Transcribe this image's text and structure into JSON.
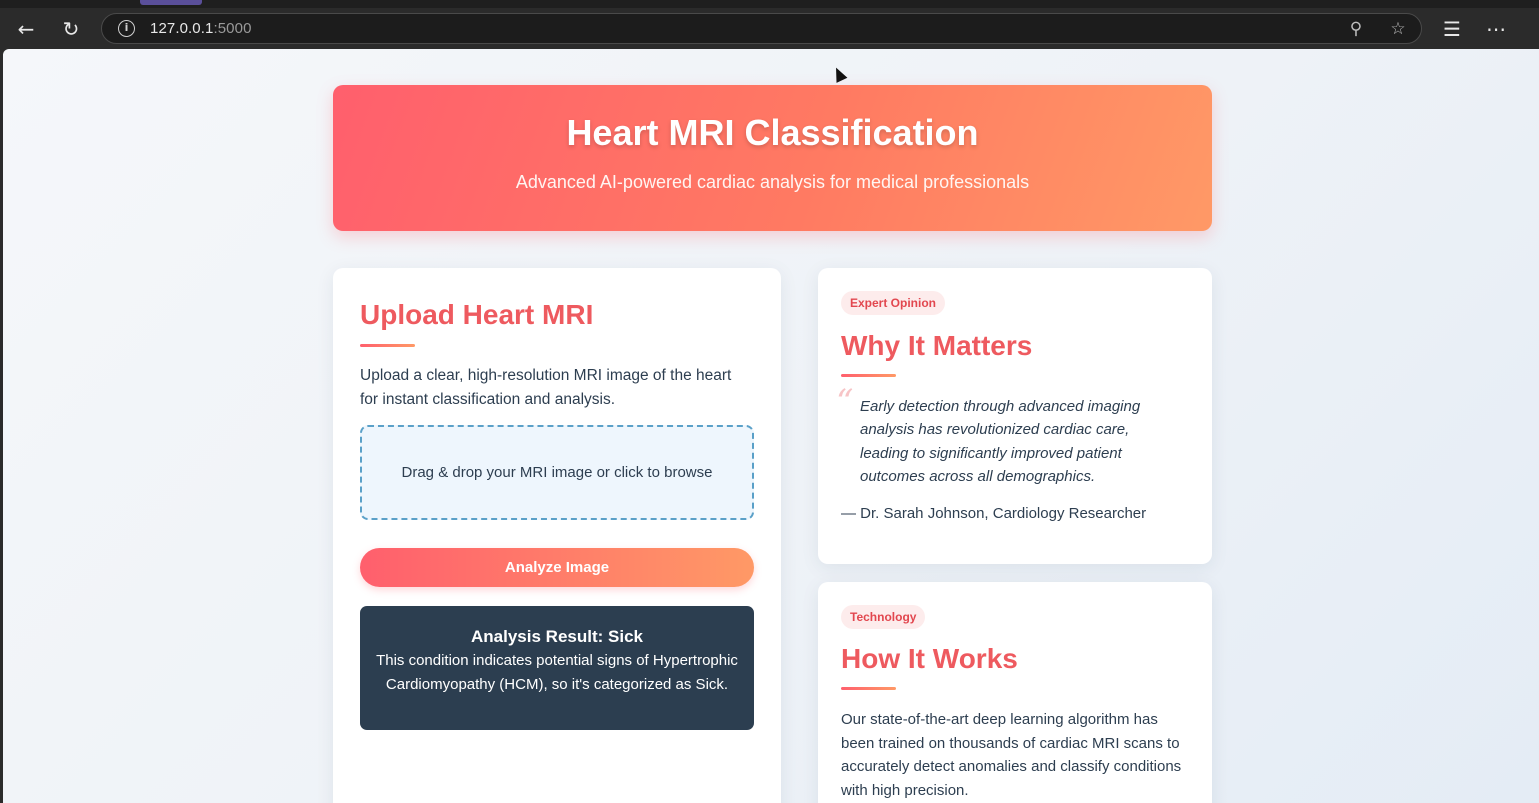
{
  "browser": {
    "url_host": "127.0.0.1",
    "url_port": ":5000",
    "icons": [
      "back-icon",
      "refresh-icon",
      "info-icon",
      "zoom-icon",
      "star-icon",
      "favorites-icon",
      "more-icon"
    ]
  },
  "hero": {
    "title": "Heart MRI Classification",
    "subtitle": "Advanced AI-powered cardiac analysis for medical professionals"
  },
  "upload": {
    "title": "Upload Heart MRI",
    "description": "Upload a clear, high-resolution MRI image of the heart for instant classification and analysis.",
    "dropzone_text": "Drag & drop your MRI image or click to browse",
    "button_label": "Analyze Image"
  },
  "result": {
    "title": "Analysis Result: Sick",
    "body": "This condition indicates potential signs of Hypertrophic Cardiomyopathy (HCM), so it's categorized as Sick."
  },
  "why": {
    "badge": "Expert Opinion",
    "title": "Why It Matters",
    "quote": "Early detection through advanced imaging analysis has revolutionized cardiac care, leading to significantly improved patient outcomes across all demographics.",
    "author": "— Dr. Sarah Johnson, Cardiology Researcher"
  },
  "how": {
    "badge": "Technology",
    "title": "How It Works",
    "description": "Our state-of-the-art deep learning algorithm has been trained on thousands of cardiac MRI scans to accurately detect anomalies and classify conditions with high precision."
  },
  "colors": {
    "accent_start": "#ff5f6d",
    "accent_end": "#ff9966",
    "heading": "#ee5a5f",
    "result_bg": "#2c3e50"
  }
}
